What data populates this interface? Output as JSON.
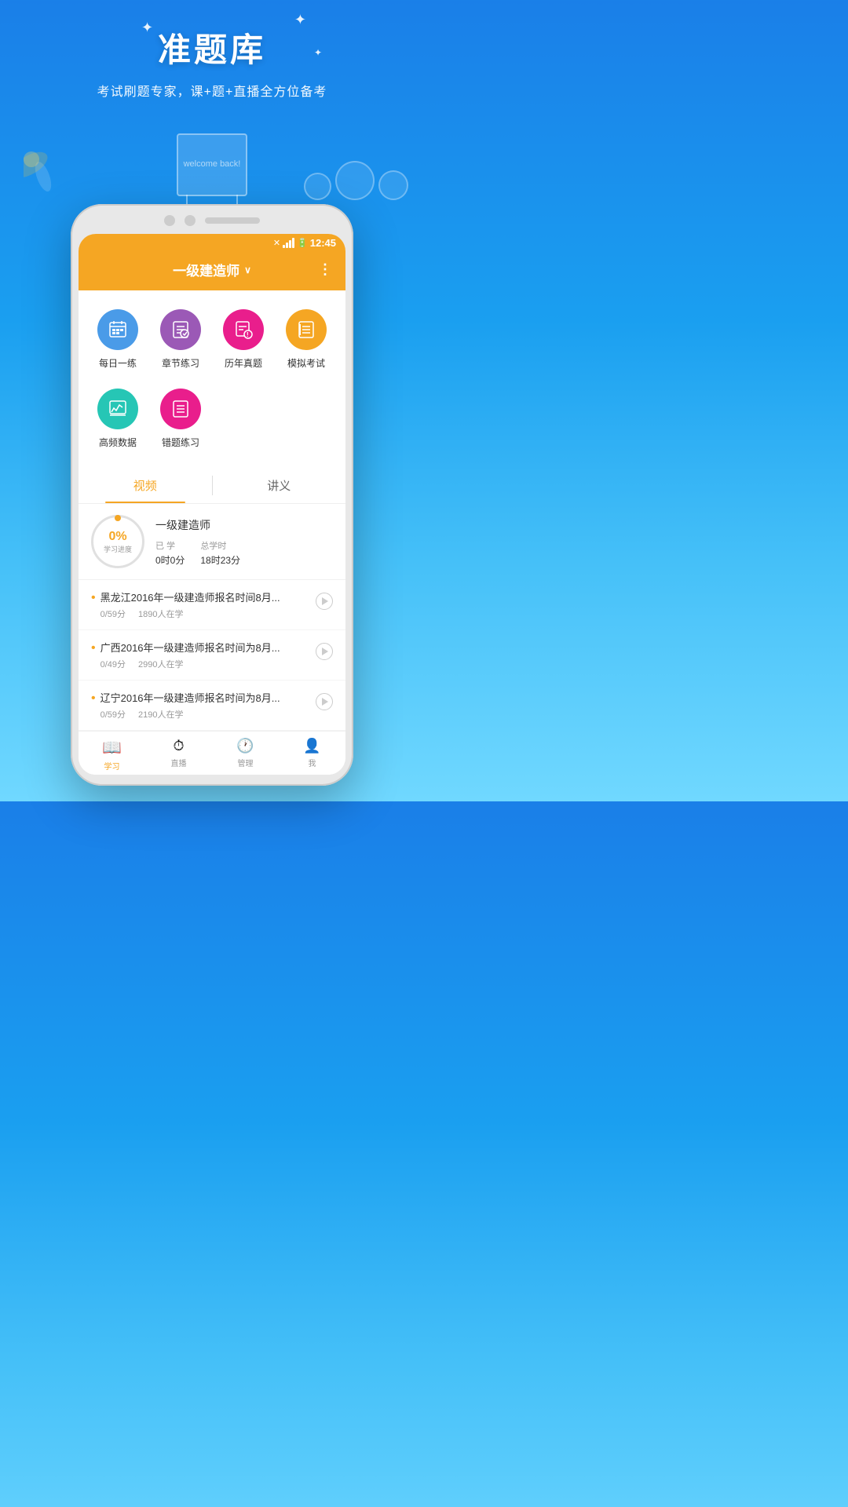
{
  "hero": {
    "title": "准题库",
    "subtitle": "考试刷题专家，课+题+直播全方位备考",
    "welcome_text": "welcome back!"
  },
  "phone": {
    "status_bar": {
      "time": "12:45"
    },
    "header": {
      "title": "一级建造师",
      "more_icon": "⋮"
    },
    "icons": [
      {
        "label": "每日一练",
        "color": "#4a9be8"
      },
      {
        "label": "章节练习",
        "color": "#9b59b6"
      },
      {
        "label": "历年真题",
        "color": "#e91e8c"
      },
      {
        "label": "模拟考试",
        "color": "#f5a623"
      },
      {
        "label": "高频数据",
        "color": "#26c6b5"
      },
      {
        "label": "错题练习",
        "color": "#e91e8c"
      }
    ],
    "tabs": [
      {
        "label": "视频",
        "active": true
      },
      {
        "label": "讲义",
        "active": false
      }
    ],
    "progress": {
      "percent": "0%",
      "label": "学习进度",
      "course": "一级建造师",
      "studied_label": "已 学",
      "studied_value": "0时0分",
      "total_label": "总学时",
      "total_value": "18时23分"
    },
    "videos": [
      {
        "title": "黑龙江2016年一级建造师报名时间8月...",
        "duration": "0/59分",
        "students": "1890人在学"
      },
      {
        "title": "广西2016年一级建造师报名时间为8月...",
        "duration": "0/49分",
        "students": "2990人在学"
      },
      {
        "title": "辽宁2016年一级建造师报名时间为8月...",
        "duration": "0/59分",
        "students": "2190人在学"
      }
    ],
    "bottom_nav": [
      {
        "label": "学习",
        "active": true,
        "icon": "📚"
      },
      {
        "label": "直播",
        "active": false,
        "icon": "📺"
      },
      {
        "label": "管理",
        "active": false,
        "icon": "🕐"
      },
      {
        "label": "我",
        "active": false,
        "icon": "👤"
      }
    ]
  }
}
